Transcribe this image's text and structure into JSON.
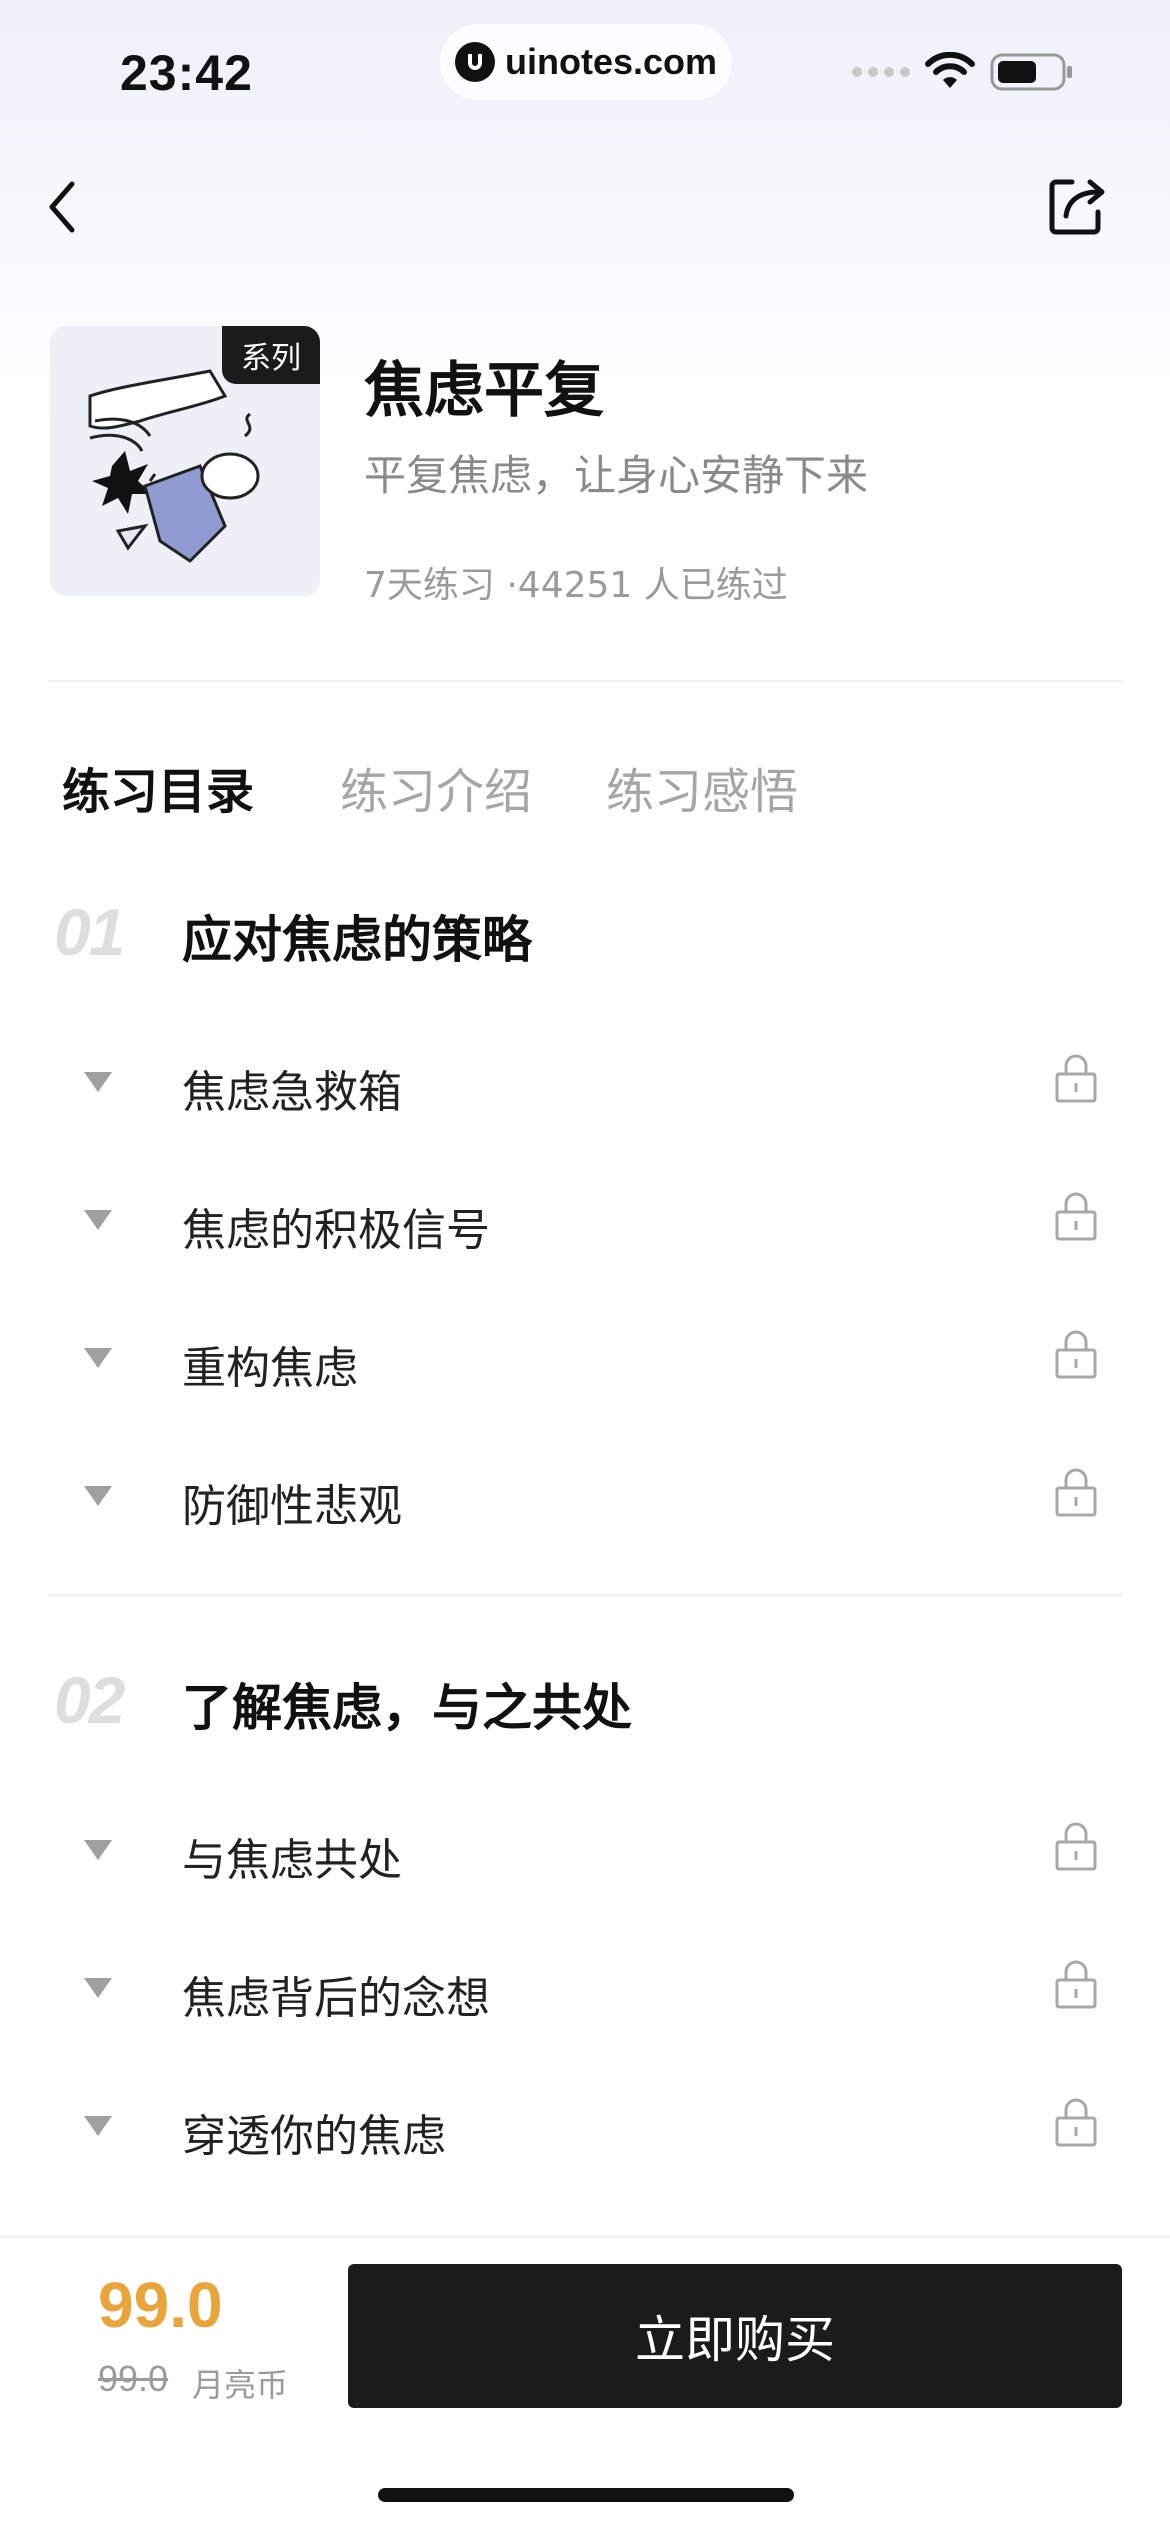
{
  "status_bar": {
    "time": "23:42",
    "url": "uinotes.com"
  },
  "course": {
    "cover_tag": "系列",
    "title": "焦虑平复",
    "subtitle": "平复焦虑，让身心安静下来",
    "meta": "7天练习 ·44251 人已练过"
  },
  "tabs": [
    {
      "label": "练习目录"
    },
    {
      "label": "练习介绍"
    },
    {
      "label": "练习感悟"
    }
  ],
  "sections": [
    {
      "number": "01",
      "title": "应对焦虑的策略",
      "lessons": [
        {
          "label": "焦虑急救箱"
        },
        {
          "label": "焦虑的积极信号"
        },
        {
          "label": "重构焦虑"
        },
        {
          "label": "防御性悲观"
        }
      ]
    },
    {
      "number": "02",
      "title": "了解焦虑，与之共处",
      "lessons": [
        {
          "label": "与焦虑共处"
        },
        {
          "label": "焦虑背后的念想"
        },
        {
          "label": "穿透你的焦虑"
        }
      ]
    }
  ],
  "purchase": {
    "price": "99.0",
    "original_price": "99.0",
    "currency": "月亮币",
    "buy_label": "立即购买"
  },
  "colors": {
    "price": "#e9a43a",
    "button": "#1b1b1b",
    "muted": "#a6a6a6"
  },
  "icons": [
    "back-icon",
    "share-icon",
    "lock-icon",
    "expand-triangle-icon",
    "wifi-icon",
    "battery-icon"
  ]
}
